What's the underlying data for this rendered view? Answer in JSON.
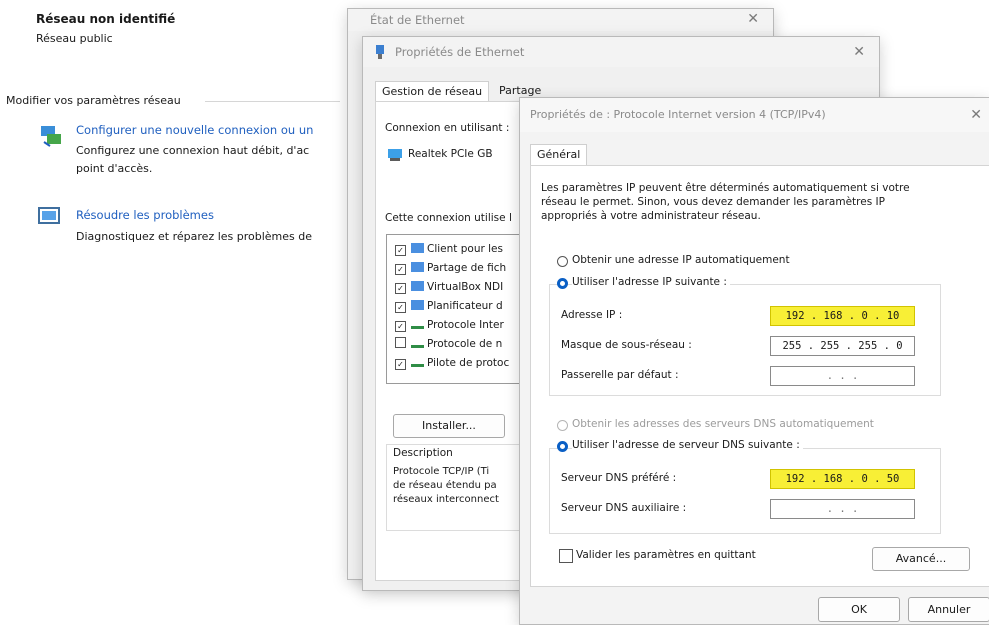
{
  "network": {
    "name": "Réseau non identifié",
    "type": "Réseau public"
  },
  "settings_section": {
    "header": "Modifier vos paramètres réseau",
    "items": [
      {
        "link": "Configurer une nouvelle connexion ou un",
        "desc_line1": "Configurez une connexion haut débit, d'ac",
        "desc_line2": "point d'accès."
      },
      {
        "link": "Résoudre les problèmes",
        "desc_line1": "Diagnostiquez et réparez les problèmes de"
      }
    ]
  },
  "status_window": {
    "title": "État de Ethernet"
  },
  "eth_props": {
    "title": "Propriétés de Ethernet",
    "tabs": [
      "Gestion de réseau",
      "Partage"
    ],
    "connect_using": "Connexion en utilisant :",
    "adapter": "Realtek PCIe GB",
    "uses_label": "Cette connexion utilise l",
    "components": [
      {
        "label": "Client pour les",
        "checked": true,
        "icon": "network-client-icon"
      },
      {
        "label": "Partage de fich",
        "checked": true,
        "icon": "file-share-icon"
      },
      {
        "label": "VirtualBox NDI",
        "checked": true,
        "icon": "virtualbox-icon"
      },
      {
        "label": "Planificateur d",
        "checked": true,
        "icon": "scheduler-icon"
      },
      {
        "label": "Protocole Inter",
        "checked": true,
        "icon": "protocol-icon"
      },
      {
        "label": "Protocole de n",
        "checked": false,
        "icon": "protocol-icon"
      },
      {
        "label": "Pilote de protoc",
        "checked": true,
        "icon": "protocol-icon"
      }
    ],
    "install_btn": "Installer...",
    "description_title": "Description",
    "description_lines": [
      "Protocole TCP/IP (Ti",
      "de réseau étendu pa",
      "réseaux interconnect"
    ]
  },
  "ipv4": {
    "title": "Propriétés de : Protocole Internet version 4 (TCP/IPv4)",
    "tab": "Général",
    "intro_lines": [
      "Les paramètres IP peuvent être déterminés automatiquement si votre",
      "réseau le permet. Sinon, vous devez demander les paramètres IP",
      "appropriés à votre administrateur réseau."
    ],
    "auto_ip": "Obtenir une adresse IP automatiquement",
    "manual_ip": "Utiliser l'adresse IP suivante :",
    "ip_label": "Adresse IP :",
    "ip_value": "192 . 168 .  0  .  10",
    "mask_label": "Masque de sous-réseau :",
    "mask_value": "255 . 255 . 255 .  0",
    "gateway_label": "Passerelle par défaut :",
    "gateway_value": ".       .       .",
    "auto_dns": "Obtenir les adresses des serveurs DNS automatiquement",
    "manual_dns": "Utiliser l'adresse de serveur DNS suivante :",
    "dns1_label": "Serveur DNS préféré :",
    "dns1_value": "192 . 168 .  0  .  50",
    "dns2_label": "Serveur DNS auxiliaire :",
    "dns2_value": ".       .       .",
    "validate": "Valider les paramètres en quittant",
    "advanced_btn": "Avancé...",
    "ok_btn": "OK",
    "cancel_btn": "Annuler"
  },
  "colors": {
    "highlight": "#f8ef36",
    "link": "#1f5fbf",
    "radio": "#0a5fc5"
  }
}
